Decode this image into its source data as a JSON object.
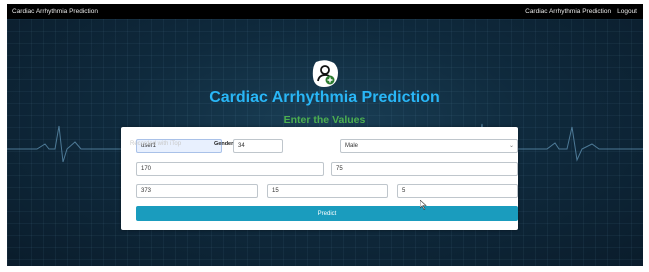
{
  "navbar": {
    "brand": "Cardiac Arrhythmia Prediction",
    "links": [
      "Cardiac Arrhythmia Prediction",
      "Logout"
    ]
  },
  "hero": {
    "icon": "user-plus-icon",
    "title": "Cardiac Arrhythmia Prediction",
    "subtitle": "Enter the Values"
  },
  "form": {
    "username_value": "user1",
    "age_value": "34",
    "age_overlay_text": "Recorded with iTop",
    "gender_label": "Gender",
    "gender_selected": "Male",
    "height_value": "170",
    "weight_value": "75",
    "field_5_value": "373",
    "field_6_value": "15",
    "field_7_value": "5",
    "predict_label": "Predict"
  },
  "colors": {
    "title": "#29b6f6",
    "subtitle": "#4caf50",
    "button": "#1a9cbe",
    "navbar": "#000000",
    "background": "#0f2a3d"
  }
}
